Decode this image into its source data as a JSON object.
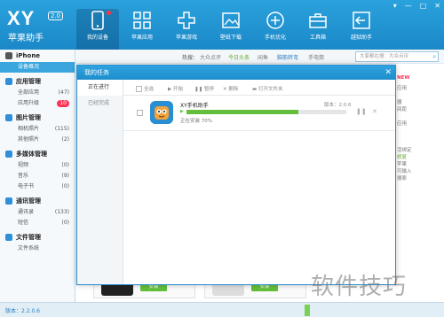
{
  "app": {
    "logo": "XY",
    "logo_version": "2.0",
    "logo_subtitle": "苹果助手"
  },
  "window_controls": [
    "▾",
    "—",
    "□",
    "✕"
  ],
  "nav": [
    {
      "label": "我的设备",
      "icon": "phone-icon"
    },
    {
      "label": "苹果应用",
      "icon": "apps-icon"
    },
    {
      "label": "苹果游戏",
      "icon": "gamepad-icon"
    },
    {
      "label": "壁纸下载",
      "icon": "picture-icon"
    },
    {
      "label": "手机优化",
      "icon": "plus-circle-icon"
    },
    {
      "label": "工具箱",
      "icon": "toolbox-icon"
    },
    {
      "label": "越狱助手",
      "icon": "arrow-icon"
    }
  ],
  "sidebar": {
    "device": "iPhone",
    "device_selected": "设备概况",
    "groups": [
      {
        "title": "应用管理",
        "color": "#2f8fd8",
        "items": [
          {
            "label": "全部应用",
            "count": "(47)"
          },
          {
            "label": "应用升级",
            "count": "10"
          }
        ]
      },
      {
        "title": "图片管理",
        "color": "#2f8fd8",
        "items": [
          {
            "label": "相机照片",
            "count": "(115)"
          },
          {
            "label": "其他照片",
            "count": "(2)"
          }
        ]
      },
      {
        "title": "多媒体管理",
        "color": "#2f8fd8",
        "items": [
          {
            "label": "视频",
            "count": "(0)"
          },
          {
            "label": "音乐",
            "count": "(9)"
          },
          {
            "label": "电子书",
            "count": "(0)"
          }
        ]
      },
      {
        "title": "通讯管理",
        "color": "#2f8fd8",
        "items": [
          {
            "label": "通讯录",
            "count": "(133)"
          },
          {
            "label": "短信",
            "count": "(0)"
          }
        ]
      },
      {
        "title": "文件管理",
        "color": "#2f8fd8",
        "items": [
          {
            "label": "文件系统",
            "count": ""
          }
        ]
      }
    ]
  },
  "hotbar": {
    "label": "热搜：",
    "items": [
      "大众点评",
      "今日头条",
      "闲鱼",
      "脑筋转弯",
      "手电筒"
    ],
    "search_placeholder": "大家都在搜：大众点评"
  },
  "background": {
    "install_label": "安装",
    "side_peek": [
      "NEW",
      "应用",
      "器",
      "间距",
      "应用",
      "活绑定",
      "苹果",
      "修复",
      "可输入",
      "搜索"
    ]
  },
  "status": {
    "version": "版本：2.2.0.6"
  },
  "modal": {
    "title": "我的任务",
    "close": "✕",
    "tabs": [
      "正在进行",
      "已经完成"
    ],
    "toolbar": {
      "select_all": "全选",
      "start": "▶ 开始",
      "pause": "❚❚ 暂停",
      "delete": "✕ 删除",
      "open_folder": "▬ 打开文件夹"
    },
    "task": {
      "name": "XY手机助手",
      "version": "版本：2.0.6",
      "status": "正在安装 70%",
      "progress": 0.7,
      "pause_icon": "❚❚",
      "delete_icon": "✕"
    }
  },
  "watermark": "软件技巧"
}
